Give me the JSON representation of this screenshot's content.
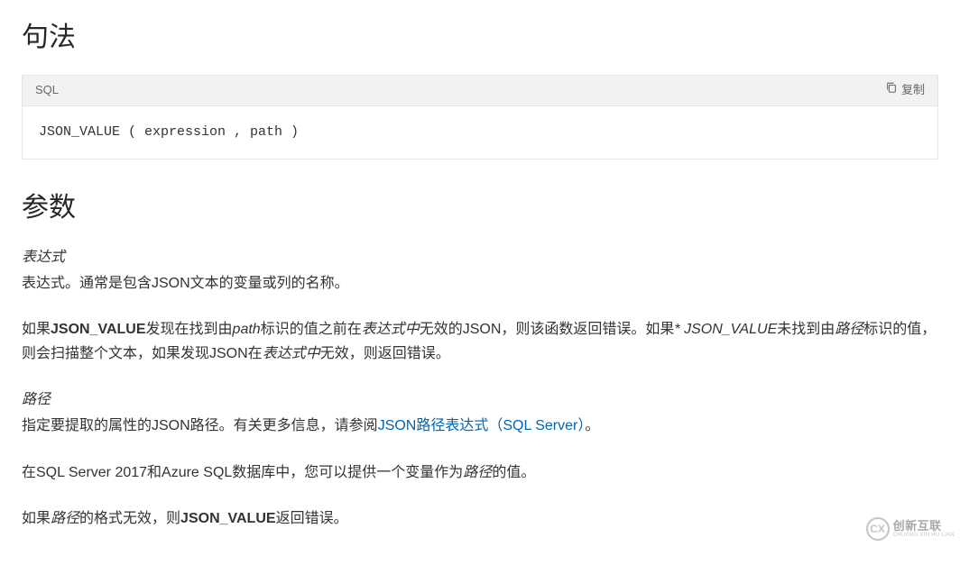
{
  "sections": {
    "syntax_heading": "句法",
    "params_heading": "参数"
  },
  "codeblock": {
    "lang": "SQL",
    "copy_label": "复制",
    "code": "JSON_VALUE ( expression , path )"
  },
  "expr": {
    "title": "表达式",
    "desc": "表达式。通常是包含JSON文本的变量或列的名称。",
    "p2_a": "如果",
    "p2_b": "JSON_VALUE",
    "p2_c": "发现在找到由",
    "p2_d": "path",
    "p2_e": "标识的值之前在",
    "p2_f": "表达式中",
    "p2_g": "无效的JSON，则该函数返回错误。如果",
    "p2_h": "* JSON_VALUE",
    "p2_i": "未找到由",
    "p2_j": "路径",
    "p2_k": "标识的值，则会扫描整个文本，如果发现JSON在",
    "p2_l": "表达式中",
    "p2_m": "无效，则返回错误。"
  },
  "path": {
    "title": "路径",
    "p1_a": "指定要提取的属性的JSON路径。有关更多信息，请参阅",
    "p1_link": "JSON路径表达式（SQL Server）",
    "p1_b": "。",
    "p2_a": "在SQL Server 2017和Azure SQL数据库中，您可以提供一个变量作为",
    "p2_b": "路径",
    "p2_c": "的值。",
    "p3_a": "如果",
    "p3_b": "路径",
    "p3_c": "的格式无效，则",
    "p3_d": "JSON_VALUE",
    "p3_e": "返回错误。"
  },
  "watermark": {
    "main": "创新互联",
    "sub": "CHUANG XIN HU LIAN"
  }
}
